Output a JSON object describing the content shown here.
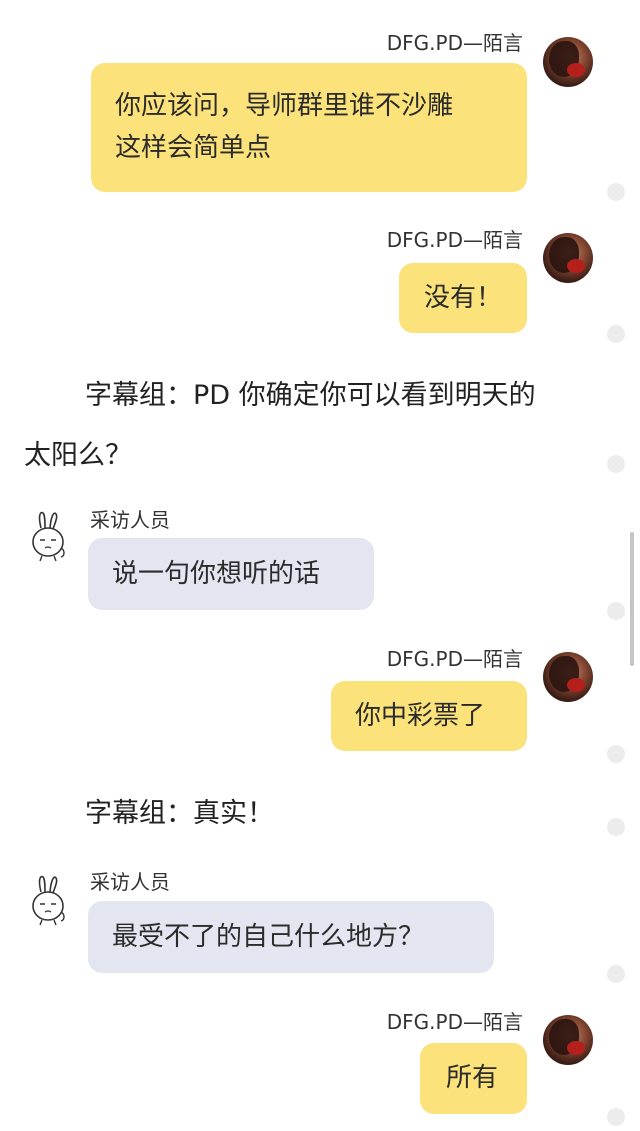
{
  "sender_me": "DFG.PD—陌言",
  "sender_them": "采访人员",
  "messages": {
    "m1": {
      "line1": "你应该问，导师群里谁不沙雕",
      "line2": "这样会简单点"
    },
    "m2": "没有！",
    "sub1": {
      "line1": "字幕组：PD 你确定你可以看到明天的",
      "line2": "太阳么？"
    },
    "m3": "说一句你想听的话",
    "m4": "你中彩票了",
    "sub2": "字幕组：真实！",
    "m5": "最受不了的自己什么地方？",
    "m6": "所有"
  },
  "colors": {
    "my_bubble": "#fbe27b",
    "their_bubble": "#e3e6f0"
  },
  "icons": {
    "my_avatar": "avatar-photo",
    "their_avatar": "rabbit-sticker-icon"
  }
}
